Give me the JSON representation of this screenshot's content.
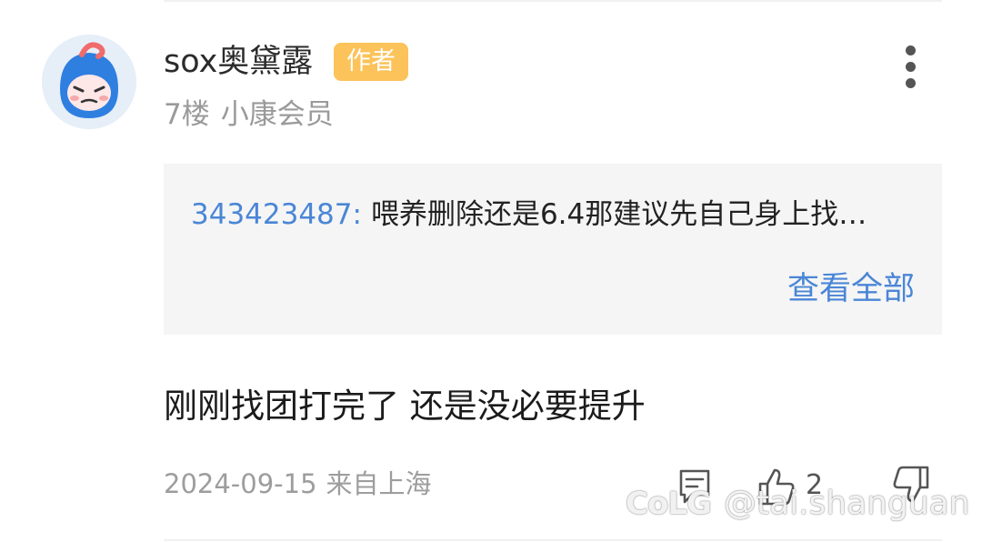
{
  "comment": {
    "username": "sox奥黛露",
    "author_badge": "作者",
    "floor": "7楼",
    "member_level": "小康会员",
    "quote": {
      "user": "343423487:",
      "text": "喂养删除还是6.4那建议先自己身上找…",
      "view_all": "查看全部"
    },
    "content": "刚刚找团打完了 还是没必要提升",
    "date": "2024-09-15",
    "location": "来自上海",
    "like_count": "2"
  },
  "icons": {
    "avatar": "cartoon-avatar-icon",
    "more": "more-vertical-icon",
    "reply": "comment-icon",
    "like": "thumbs-up-icon",
    "dislike": "thumbs-down-icon"
  },
  "watermark": {
    "logo": "CoLG",
    "handle": "@tai.shanguan"
  },
  "colors": {
    "badge": "#fbc35a",
    "link": "#4a86d6",
    "quote_bg": "#f5f5f5",
    "muted_text": "#9a9a9a"
  }
}
